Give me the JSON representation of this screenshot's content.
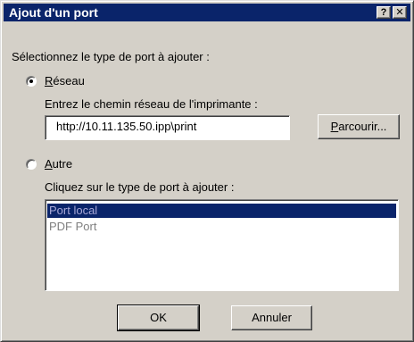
{
  "window": {
    "title": "Ajout d'un port",
    "help_button": "?",
    "close_button": "✕"
  },
  "prompt_label": "Sélectionnez le type de port à ajouter :",
  "network_option": {
    "label_first": "R",
    "label_rest": "éseau",
    "selected": true,
    "path_label": "Entrez le chemin réseau de l'imprimante :",
    "path_value": "http://10.11.135.50.ipp\\print",
    "browse_first": "P",
    "browse_rest": "arcourir..."
  },
  "other_option": {
    "label_first": "A",
    "label_rest": "utre",
    "selected": false,
    "list_label": "Cliquez sur le type de port à ajouter :",
    "port_types": [
      "Port local",
      "PDF Port"
    ],
    "selected_port": "Port local"
  },
  "buttons": {
    "ok": "OK",
    "cancel": "Annuler"
  },
  "colors": {
    "title_bar": "#0a246a",
    "dialog_face": "#d4d0c8",
    "selection": "#0a246a"
  }
}
